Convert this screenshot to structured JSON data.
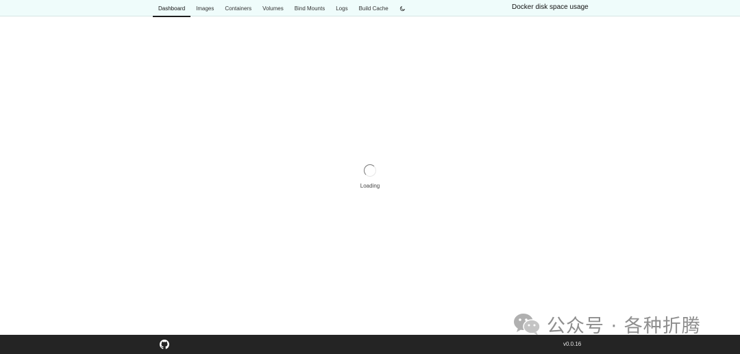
{
  "app": {
    "title": "Docker disk space usage"
  },
  "nav": {
    "tabs": [
      {
        "label": "Dashboard",
        "active": true
      },
      {
        "label": "Images",
        "active": false
      },
      {
        "label": "Containers",
        "active": false
      },
      {
        "label": "Volumes",
        "active": false
      },
      {
        "label": "Bind Mounts",
        "active": false
      },
      {
        "label": "Logs",
        "active": false
      },
      {
        "label": "Build Cache",
        "active": false
      }
    ],
    "theme_toggle_icon": "moon-icon"
  },
  "main": {
    "loading_text": "Loading"
  },
  "watermark": {
    "icon": "wechat-icon",
    "text": "公众号 · 各种折腾"
  },
  "footer": {
    "github_icon": "github-icon",
    "version": "v0.0.16"
  },
  "colors": {
    "header_bg": "#effcfb",
    "footer_bg": "#242424",
    "active_tab_underline": "#1d1d1d"
  }
}
